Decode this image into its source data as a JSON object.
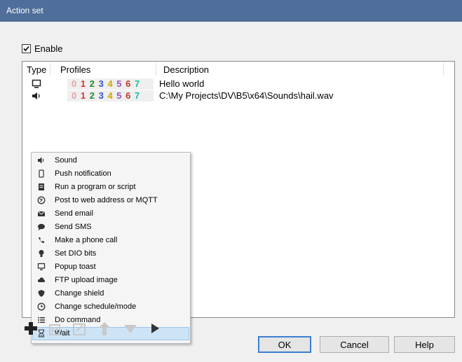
{
  "window": {
    "title": "Action set"
  },
  "enable": {
    "label": "Enable",
    "checked": true
  },
  "list": {
    "columns": [
      "Type",
      "Profiles",
      "Description"
    ],
    "rows": [
      {
        "type_icon": "monitor-icon",
        "profiles": [
          "0",
          "1",
          "2",
          "3",
          "4",
          "5",
          "6",
          "7"
        ],
        "description": "Hello world"
      },
      {
        "type_icon": "speaker-icon",
        "profiles": [
          "0",
          "1",
          "2",
          "3",
          "4",
          "5",
          "6",
          "7"
        ],
        "description": "C:\\My Projects\\DV\\B5\\x64\\Sounds\\hail.wav"
      }
    ]
  },
  "context_menu": {
    "items": [
      {
        "label": "Sound",
        "icon": "speaker-icon"
      },
      {
        "label": "Push notification",
        "icon": "phone-icon"
      },
      {
        "label": "Run a program or script",
        "icon": "script-icon"
      },
      {
        "label": "Post to web address or MQTT",
        "icon": "globe-icon"
      },
      {
        "label": "Send email",
        "icon": "envelope-icon"
      },
      {
        "label": "Send SMS",
        "icon": "chat-bubble-icon"
      },
      {
        "label": "Make a phone call",
        "icon": "phone-call-icon"
      },
      {
        "label": "Set DIO bits",
        "icon": "lightbulb-icon"
      },
      {
        "label": "Popup toast",
        "icon": "monitor-icon"
      },
      {
        "label": "FTP upload image",
        "icon": "cloud-upload-icon"
      },
      {
        "label": "Change shield",
        "icon": "shield-icon"
      },
      {
        "label": "Change schedule/mode",
        "icon": "clock-icon"
      },
      {
        "label": "Do command",
        "icon": "list-icon"
      },
      {
        "label": "Wait",
        "icon": "hourglass-icon",
        "highlighted": true
      }
    ]
  },
  "toolbar": {
    "add": "plus-icon",
    "delete": "trash-icon",
    "edit": "edit-icon",
    "move_up": "arrow-up-icon",
    "move_down": "arrow-down-icon",
    "test": "arrow-right-icon"
  },
  "buttons": {
    "ok": "OK",
    "cancel": "Cancel",
    "help": "Help"
  },
  "colors": {
    "titlebar": "#4f6f9a",
    "highlight": "#cde4f7",
    "ok_border": "#3c7fd1"
  }
}
